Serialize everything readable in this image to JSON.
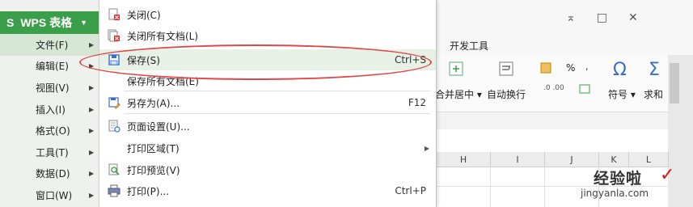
{
  "app": {
    "logo": "S",
    "title": "WPS 表格",
    "dropdown_glyph": "▼"
  },
  "window_controls": {
    "restore": "⌅",
    "minimize": "□",
    "close": "✕"
  },
  "ribbon": {
    "tab_dev": "开发工具",
    "merge_center": "合并居中",
    "wrap_text": "自动换行",
    "symbol": "符号",
    "sum": "求和",
    "percent": "%",
    "omega": "Ω",
    "sigma": "Σ"
  },
  "left_menu": {
    "items": [
      {
        "label": "文件(F)",
        "arrow": "▶"
      },
      {
        "label": "编辑(E)",
        "arrow": "▶"
      },
      {
        "label": "视图(V)",
        "arrow": "▶"
      },
      {
        "label": "插入(I)",
        "arrow": "▶"
      },
      {
        "label": "格式(O)",
        "arrow": "▶"
      },
      {
        "label": "工具(T)",
        "arrow": "▶"
      },
      {
        "label": "数据(D)",
        "arrow": "▶"
      },
      {
        "label": "窗口(W)",
        "arrow": "▶"
      }
    ]
  },
  "file_menu": {
    "items": [
      {
        "label": "关闭(C)",
        "shortcut": "",
        "icon": "close-doc-icon"
      },
      {
        "label": "关闭所有文档(L)",
        "shortcut": "",
        "icon": "close-all-docs-icon"
      },
      {
        "label": "保存(S)",
        "shortcut": "Ctrl+S",
        "icon": "save-icon"
      },
      {
        "label": "保存所有文档(E)",
        "shortcut": "",
        "icon": ""
      },
      {
        "label": "另存为(A)...",
        "shortcut": "F12",
        "icon": "save-as-icon"
      },
      {
        "label": "页面设置(U)...",
        "shortcut": "",
        "icon": "page-setup-icon"
      },
      {
        "label": "打印区域(T)",
        "shortcut": "",
        "icon": ""
      },
      {
        "label": "打印预览(V)",
        "shortcut": "",
        "icon": "print-preview-icon"
      },
      {
        "label": "打印(P)...",
        "shortcut": "Ctrl+P",
        "icon": "print-icon"
      }
    ],
    "submenu_arrow": "▶"
  },
  "sheet": {
    "columns": [
      "H",
      "I",
      "J",
      "K",
      "L"
    ]
  },
  "watermark": {
    "cn": "经验啦",
    "en": "jingyanla.com",
    "check": "✓"
  },
  "colors": {
    "brand_green": "#3b9e48",
    "highlight": "#e7f1e6",
    "annotation_red": "#e04848"
  }
}
